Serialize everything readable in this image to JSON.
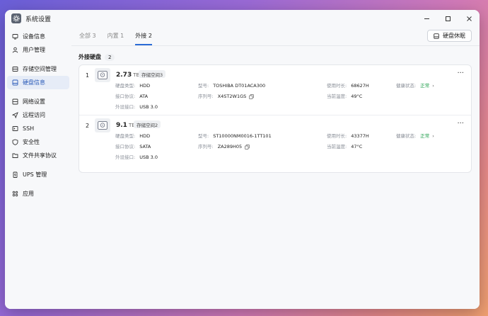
{
  "window": {
    "title": "系统设置"
  },
  "sidebar": {
    "groups": [
      [
        {
          "label": "设备信息",
          "icon": "monitor-icon"
        },
        {
          "label": "用户管理",
          "icon": "user-icon"
        }
      ],
      [
        {
          "label": "存储空间管理",
          "icon": "storage-icon"
        },
        {
          "label": "硬盘信息",
          "icon": "disk-icon",
          "active": true
        }
      ],
      [
        {
          "label": "网络设置",
          "icon": "network-icon"
        },
        {
          "label": "远程访问",
          "icon": "send-icon"
        },
        {
          "label": "SSH",
          "icon": "terminal-icon"
        },
        {
          "label": "安全性",
          "icon": "shield-icon"
        },
        {
          "label": "文件共享协议",
          "icon": "folder-icon"
        }
      ],
      [
        {
          "label": "UPS 管理",
          "icon": "ups-icon"
        }
      ],
      [
        {
          "label": "应用",
          "icon": "apps-icon"
        }
      ]
    ]
  },
  "tabs": [
    {
      "label": "全部 3",
      "active": false
    },
    {
      "label": "内置 1",
      "active": false
    },
    {
      "label": "外接 2",
      "active": true
    }
  ],
  "toolbar": {
    "sleep_label": "硬盘休眠"
  },
  "section": {
    "title": "外接硬盘",
    "count": "2"
  },
  "disks": [
    {
      "index": "1",
      "size": "2.73",
      "unit": "TB",
      "pool": "存储空间3",
      "type_key": "硬盘类型:",
      "type": "HDD",
      "model_key": "型号:",
      "model": "TOSHIBA DT01ACA300",
      "uptime_key": "使用时长:",
      "uptime": "68627H",
      "health_key": "健康状态:",
      "health": "正常",
      "iface_key": "接口协议:",
      "iface": "ATA",
      "serial_key": "序列号:",
      "serial": "X4ST2W1GS",
      "temp_key": "当前温度:",
      "temp": "49°C",
      "port_key": "外设接口:",
      "port": "USB 3.0"
    },
    {
      "index": "2",
      "size": "9.1",
      "unit": "TB",
      "pool": "存储空间2",
      "type_key": "硬盘类型:",
      "type": "HDD",
      "model_key": "型号:",
      "model": "ST10000NM0016-1TT101",
      "uptime_key": "使用时长:",
      "uptime": "43377H",
      "health_key": "健康状态:",
      "health": "正常",
      "iface_key": "接口协议:",
      "iface": "SATA",
      "serial_key": "序列号:",
      "serial": "ZA289H05",
      "temp_key": "当前温度:",
      "temp": "47°C",
      "port_key": "外设接口:",
      "port": "USB 3.0"
    }
  ],
  "colors": {
    "accent": "#2b6cd6",
    "health_ok": "#1e9e4a",
    "active_bg": "#e6ecf7"
  }
}
